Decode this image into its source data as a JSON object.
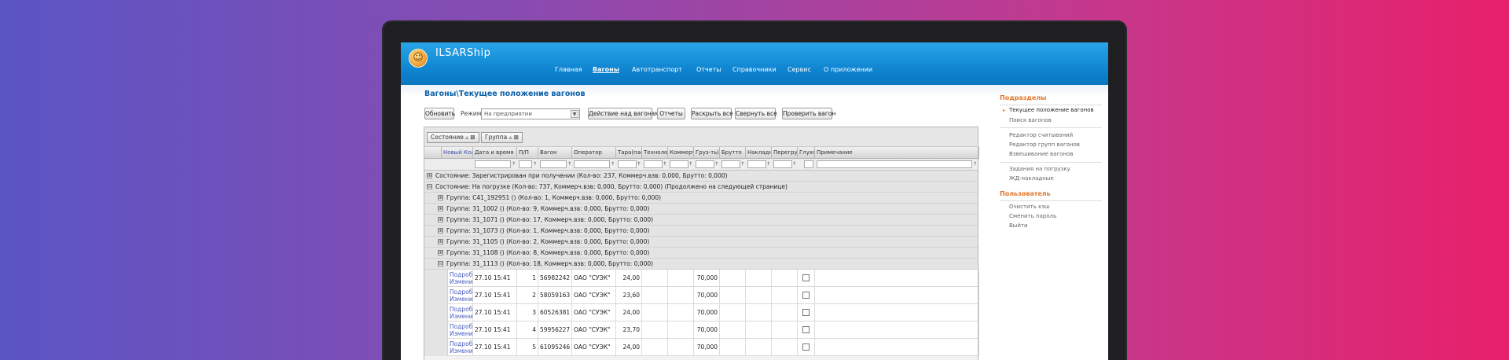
{
  "app": {
    "title": "ILSARShip",
    "logo_glyph": "☺"
  },
  "nav": {
    "items": [
      {
        "label": "Главная",
        "active": false
      },
      {
        "label": "Вагоны",
        "active": true
      },
      {
        "label": "Автотранспорт",
        "active": false
      },
      {
        "label": "Отчеты",
        "active": false
      },
      {
        "label": "Справочники",
        "active": false
      },
      {
        "label": "Сервис",
        "active": false
      },
      {
        "label": "О приложении",
        "active": false
      }
    ]
  },
  "page": {
    "title": "Вагоны\\Текущее положение вагонов"
  },
  "toolbar": {
    "refresh_label": "Обновить",
    "mode_label": "Режим:",
    "mode_value": "На предприятии",
    "action_label": "Действие над вагонами",
    "reports_label": "Отчеты",
    "expand_label": "Раскрыть все",
    "collapse_label": "Свернуть все",
    "check_label": "Проверить вагон"
  },
  "grouping": {
    "chips": [
      "Состояние",
      "Группа"
    ]
  },
  "columns": [
    "Новый Кол.",
    "Дата и время",
    "П/П",
    "Вагон",
    "Оператор",
    "Тара(паспорт)",
    "Технолог.",
    "Коммерч.вз.",
    "Груз-ть(паспорт)",
    "Брутто",
    "Накладная",
    "Перегруз",
    "Глухой",
    "Примечание"
  ],
  "groups": [
    {
      "level": 0,
      "sign": "⊞",
      "text": "Состояние: Зарегистрирован при получении (Кол-во: 237, Коммерч.взв: 0,000, Брутто: 0,000)"
    },
    {
      "level": 0,
      "sign": "⊟",
      "text": "Состояние: На погрузке (Кол-во: 737, Коммерч.взв: 0,000, Брутто: 0,000) (Продолжено на следующей странице)"
    },
    {
      "level": 1,
      "sign": "⊞",
      "text": "Группа: С41_192951 () (Кол-во: 1, Коммерч.взв: 0,000, Брутто: 0,000)"
    },
    {
      "level": 1,
      "sign": "⊞",
      "text": "Группа: 31_1002 () (Кол-во: 9, Коммерч.взв: 0,000, Брутто: 0,000)"
    },
    {
      "level": 1,
      "sign": "⊞",
      "text": "Группа: 31_1071 () (Кол-во: 17, Коммерч.взв: 0,000, Брутто: 0,000)"
    },
    {
      "level": 1,
      "sign": "⊞",
      "text": "Группа: 31_1073 () (Кол-во: 1, Коммерч.взв: 0,000, Брутто: 0,000)"
    },
    {
      "level": 1,
      "sign": "⊞",
      "text": "Группа: 31_1105 () (Кол-во: 2, Коммерч.взв: 0,000, Брутто: 0,000)"
    },
    {
      "level": 1,
      "sign": "⊞",
      "text": "Группа: 31_1108 () (Кол-во: 8, Коммерч.взв: 0,000, Брутто: 0,000)"
    },
    {
      "level": 1,
      "sign": "⊟",
      "text": "Группа: 31_1113 () (Кол-во: 18, Коммерч.взв: 0,000, Брутто: 0,000)"
    }
  ],
  "rows": [
    {
      "more": "Подробно",
      "edit": "Изменить",
      "datetime": "27.10 15:41",
      "pp": "1",
      "wagon": "56982242",
      "operator": "ОАО \"СУЭК\"",
      "tara": "24,00",
      "capacity": "70,000"
    },
    {
      "more": "Подробно",
      "edit": "Изменить",
      "datetime": "27.10 15:41",
      "pp": "2",
      "wagon": "58059163",
      "operator": "ОАО \"СУЭК\"",
      "tara": "23,60",
      "capacity": "70,000"
    },
    {
      "more": "Подробно",
      "edit": "Изменить",
      "datetime": "27.10 15:41",
      "pp": "3",
      "wagon": "60526381",
      "operator": "ОАО \"СУЭК\"",
      "tara": "24,00",
      "capacity": "70,000"
    },
    {
      "more": "Подробно",
      "edit": "Изменить",
      "datetime": "27.10 15:41",
      "pp": "4",
      "wagon": "59956227",
      "operator": "ОАО \"СУЭК\"",
      "tara": "23,70",
      "capacity": "70,000"
    },
    {
      "more": "Подробно",
      "edit": "Изменить",
      "datetime": "27.10 15:41",
      "pp": "5",
      "wagon": "61095246",
      "operator": "ОАО \"СУЭК\"",
      "tara": "24,00",
      "capacity": "70,000"
    }
  ],
  "sidebar": {
    "sections": [
      {
        "title": "Подразделы",
        "items": [
          "Текущее положение вагонов",
          "Поиск вагонов",
          "Редактор считываний",
          "Редактор групп вагонов",
          "Взвешивание вагонов",
          "Задания на погрузку",
          "ЖД-накладные"
        ]
      },
      {
        "title": "Пользователь",
        "items": [
          "Очистить кэш",
          "Сменить пароль",
          "Выйти"
        ]
      }
    ]
  }
}
